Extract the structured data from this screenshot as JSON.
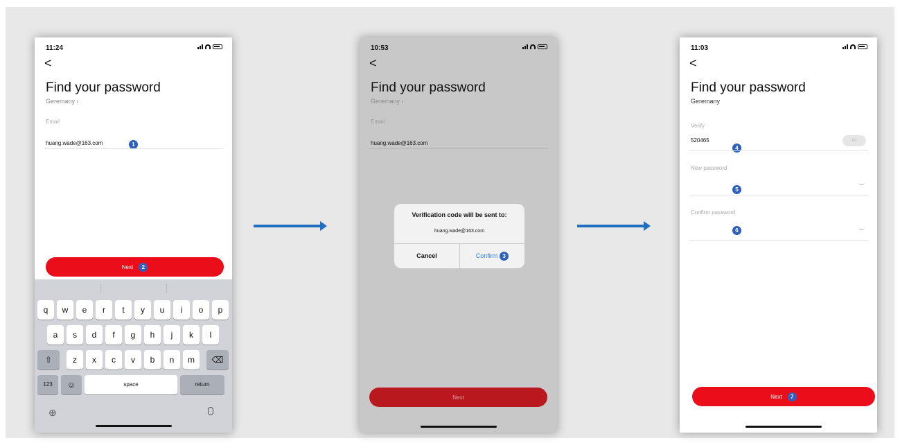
{
  "screen1": {
    "time": "11:24",
    "back": "<",
    "title": "Find your password",
    "region": "Geremany ›",
    "email_label": "Email",
    "email_value": "huang.wade@163.com",
    "next_label": "Next",
    "badges": [
      "1",
      "2"
    ],
    "keyboard": {
      "row1": [
        "q",
        "w",
        "e",
        "r",
        "t",
        "y",
        "u",
        "i",
        "o",
        "p"
      ],
      "row2": [
        "a",
        "s",
        "d",
        "f",
        "g",
        "h",
        "j",
        "k",
        "l"
      ],
      "row3": [
        "z",
        "x",
        "c",
        "v",
        "b",
        "n",
        "m"
      ],
      "numbers_key": "123",
      "space_key": "space",
      "return_key": "return"
    }
  },
  "screen2": {
    "time": "10:53",
    "back": "<",
    "title": "Find your password",
    "region": "Geremany ›",
    "email_label": "Email",
    "email_value": "huang.wade@163.com",
    "dialog": {
      "title": "Verification code will be sent to:",
      "email": "huang.wade@163.com",
      "cancel": "Cancel",
      "confirm": "Confirm"
    },
    "badges": [
      "3"
    ],
    "next_label": "Next"
  },
  "screen3": {
    "time": "11:03",
    "back": "<",
    "title": "Find your password",
    "region": "Geremany",
    "verify_label": "Verify",
    "verify_value": "520465",
    "send_label": "8s",
    "new_password_label": "New password",
    "confirm_password_label": "Confirm password",
    "next_label": "Next",
    "badges": [
      "4",
      "5",
      "6",
      "7"
    ]
  },
  "colors": {
    "accent_red": "#ec0d1a",
    "badge_blue": "#2e5fbf",
    "arrow_blue": "#1f6ec0",
    "ios_link_blue": "#2f7de1"
  },
  "icons": [
    "signal-icon",
    "wifi-icon",
    "battery-icon",
    "back-chevron-icon",
    "shift-icon",
    "backspace-icon",
    "emoji-icon",
    "globe-icon",
    "microphone-icon",
    "eye-icon",
    "right-arrow-icon"
  ]
}
